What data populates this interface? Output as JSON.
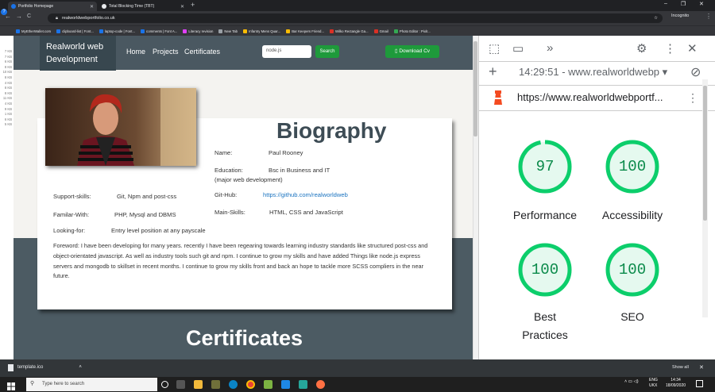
{
  "browser": {
    "tabs": [
      {
        "label": "Portfolio Homepage",
        "active": true
      },
      {
        "label": "Total Blocking Time (TBT)",
        "active": false
      }
    ],
    "url": "realworldwebportfolio.co.uk",
    "profile": "Incognito",
    "bookmarks": [
      {
        "label": "MyEtherWallet.com",
        "color": "#1a73e8"
      },
      {
        "label": "clipboard-list | Font...",
        "color": "#1a73e8"
      },
      {
        "label": "laptop-code | Font...",
        "color": "#1a73e8"
      },
      {
        "label": "comments | Font A...",
        "color": "#1a73e8"
      },
      {
        "label": "Literacy revision",
        "color": "#e040fb"
      },
      {
        "label": "New Tab",
        "color": "#9aa0a6"
      },
      {
        "label": "Infantry Mens Quar...",
        "color": "#fbbc04"
      },
      {
        "label": "Bar Keepers Friend...",
        "color": "#fbbc04"
      },
      {
        "label": "Wilko Rectangle Ga...",
        "color": "#d93025"
      },
      {
        "label": "Gmail",
        "color": "#d93025"
      },
      {
        "label": "Photo Editor : Pixlr...",
        "color": "#34a853"
      }
    ]
  },
  "network_sizes": [
    "7 KB",
    "7 KB",
    "6 KB",
    "8 KB",
    "10 KB",
    "8 KB",
    "4 KB",
    "8 KB",
    "8 KB",
    "11 KB",
    "4 KB",
    "9 KB",
    "1 KB",
    "6 KB",
    "5 KB"
  ],
  "site": {
    "logo_line1": "Realworld web",
    "logo_line2": "Development",
    "nav": [
      "Home",
      "Projects",
      "Certificates"
    ],
    "search_value": "node.js",
    "search_button": "Search",
    "download_cv": "Download Cv",
    "bio_heading": "Biography",
    "details": {
      "name_label": "Name:",
      "name_value": "Paul Rooney",
      "education_label": "Education:",
      "education_value": "Bsc in Business and IT",
      "education_sub": "(major web development)",
      "github_label": "Git-Hub:",
      "github_value": "https://github.com/realworldweb",
      "mainskills_label": "Main-Skills:",
      "mainskills_value": "HTML, CSS and JavaScript",
      "support_label": "Support-skills:",
      "support_value": "Git, Npm and post-css",
      "familiar_label": "Familar-With:",
      "familiar_value": "PHP, Mysql and DBMS",
      "looking_label": "Looking-for:",
      "looking_value": "Entry level position at any payscale"
    },
    "foreword": "Foreword:   I have been developing for many years. recently I have been regearing towards learning industry standards like structured post-css and object-orientated javascript. As well as industry tools such git and npm. I continue to grow my skills and have added Things like node.js express servers and mongodb to skillset in recent months. I continue to grow my skills front and back an hope to tackle more SCSS compliers in the near future.",
    "certificates_heading": "Certificates"
  },
  "devtools": {
    "runtime": "14:29:51 - www.realworldwebp",
    "audit_url": "https://www.realworldwebportf...",
    "scores": [
      {
        "label": "Performance",
        "score": 97,
        "color": "#0cce6b"
      },
      {
        "label": "Accessibility",
        "score": 100,
        "color": "#0cce6b"
      },
      {
        "label": "Best Practices",
        "score": 100,
        "color": "#0cce6b"
      },
      {
        "label": "SEO",
        "score": 100,
        "color": "#0cce6b"
      }
    ]
  },
  "downloads": {
    "file": "template.ico",
    "show_all": "Show all"
  },
  "taskbar": {
    "search_placeholder": "Type here to search",
    "lang": "ENG",
    "region": "UKX",
    "time": "14:34",
    "date": "18/09/2020"
  }
}
